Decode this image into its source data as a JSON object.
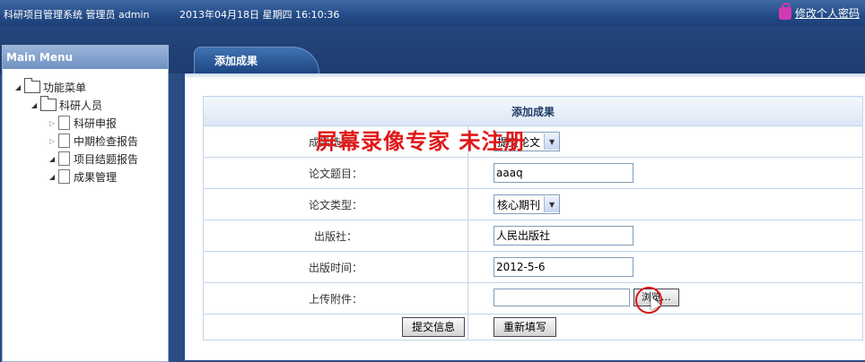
{
  "header": {
    "app_title": "科研项目管理系统",
    "role": "管理员",
    "user": "admin",
    "datetime": "2013年04月18日 星期四 16:10:36",
    "change_password": "修改个人密码"
  },
  "sidebar": {
    "title": "Main Menu",
    "tree": {
      "root": "功能菜单",
      "group": "科研人员",
      "items": [
        "科研申报",
        "中期检查报告",
        "项目结题报告",
        "成果管理"
      ]
    }
  },
  "tab": {
    "label": "添加成果"
  },
  "form": {
    "title": "添加成果",
    "rows": [
      {
        "label": "成果选择：",
        "value": "提交论文"
      },
      {
        "label": "论文题目：",
        "value": "aaaq"
      },
      {
        "label": "论文类型：",
        "value": "核心期刊"
      },
      {
        "label": "出版社：",
        "value": "人民出版社"
      },
      {
        "label": "出版时间：",
        "value": "2012-5-6"
      },
      {
        "label": "上传附件：",
        "browse": "浏览..."
      }
    ],
    "submit": "提交信息",
    "reset": "重新填写"
  },
  "overlay": {
    "watermark": "屏幕录像专家 未注册"
  }
}
